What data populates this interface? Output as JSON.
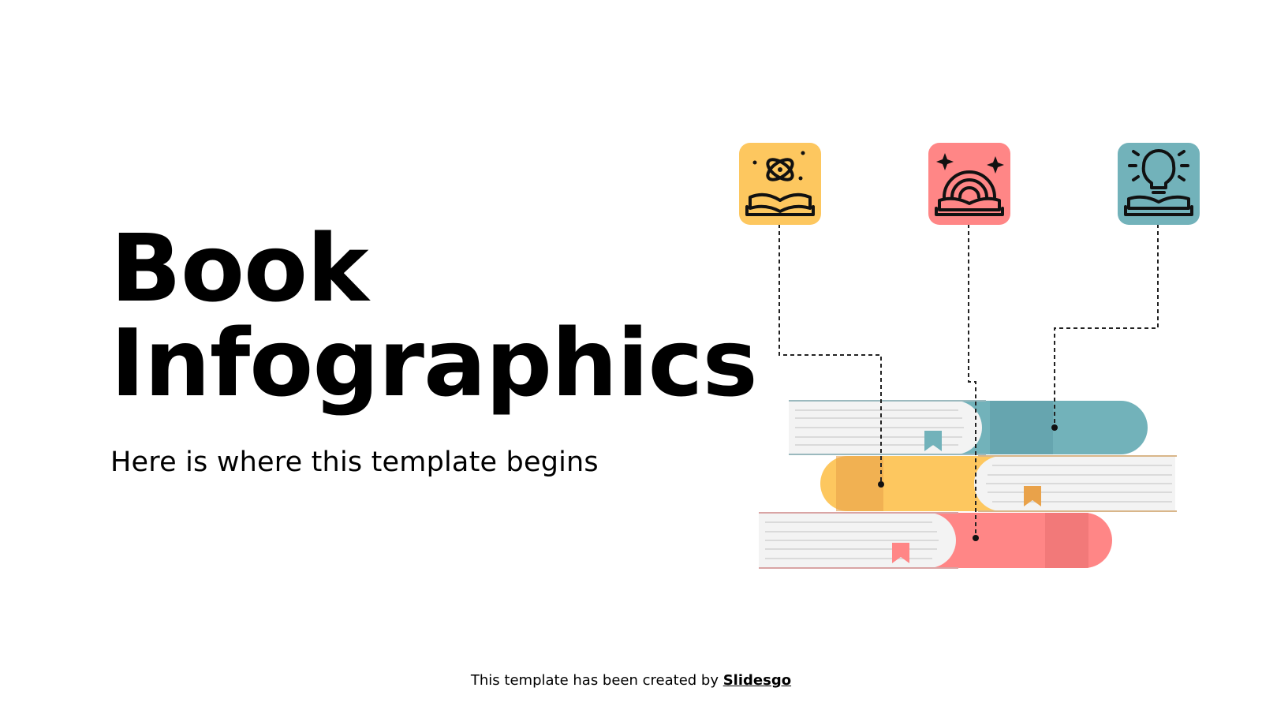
{
  "slide": {
    "title_line1": "Book",
    "title_line2": "Infographics",
    "subtitle": "Here is where this template begins"
  },
  "footer": {
    "credit_text": "This template has been created by ",
    "credit_link": "Slidesgo"
  },
  "colors": {
    "yellow": "#FDC75F",
    "yellow_dark": "#E9A24A",
    "pink": "#FF8686",
    "pink_dark": "#E86F70",
    "teal": "#72B2BA",
    "teal_dark": "#5D9BA5",
    "pages": "#EFEFEF"
  },
  "icons": [
    {
      "name": "atom-book-icon",
      "color": "#FDC75F"
    },
    {
      "name": "rainbow-book-icon",
      "color": "#FF8686"
    },
    {
      "name": "lightbulb-book-icon",
      "color": "#72B2BA"
    }
  ]
}
